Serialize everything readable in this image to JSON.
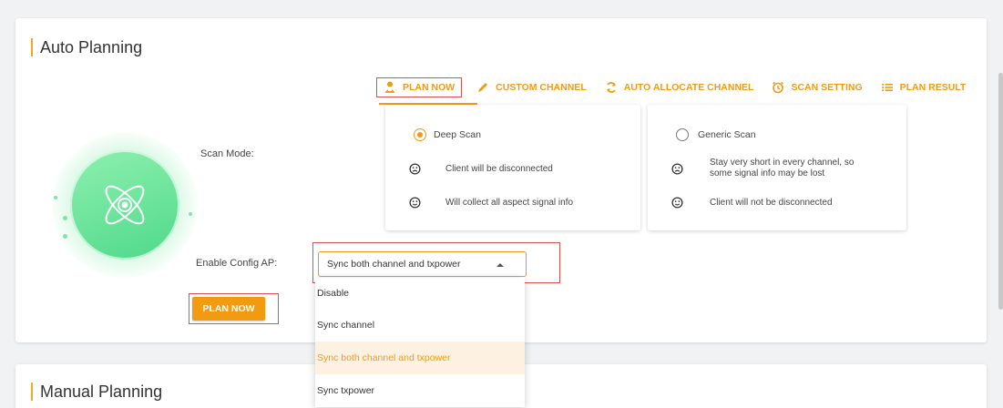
{
  "auto": {
    "title": "Auto Planning",
    "tabs": [
      {
        "label": "PLAN NOW",
        "icon": "person-icon"
      },
      {
        "label": "CUSTOM CHANNEL",
        "icon": "pencil-icon"
      },
      {
        "label": "AUTO ALLOCATE CHANNEL",
        "icon": "refresh-icon"
      },
      {
        "label": "SCAN SETTING",
        "icon": "alarm-icon"
      },
      {
        "label": "PLAN RESULT",
        "icon": "list-icon"
      }
    ],
    "scan_mode_label": "Scan Mode:",
    "enable_config_label": "Enable Config AP:",
    "deep": {
      "title": "Deep Scan",
      "items": [
        "Client will be disconnected",
        "Will collect all aspect signal info"
      ]
    },
    "generic": {
      "title": "Generic Scan",
      "items": [
        "Stay very short in every channel, so",
        "some signal info may be lost",
        "Client will not be disconnected"
      ]
    },
    "select_value": "Sync both channel and txpower",
    "options": [
      "Disable",
      "Sync channel",
      "Sync both channel and txpower",
      "Sync txpower"
    ],
    "plan_button": "PLAN NOW"
  },
  "manual": {
    "title": "Manual Planning"
  },
  "colors": {
    "accent": "#f29b11",
    "highlight_border": "#d9534f",
    "hero_green": "#4fd98a"
  }
}
